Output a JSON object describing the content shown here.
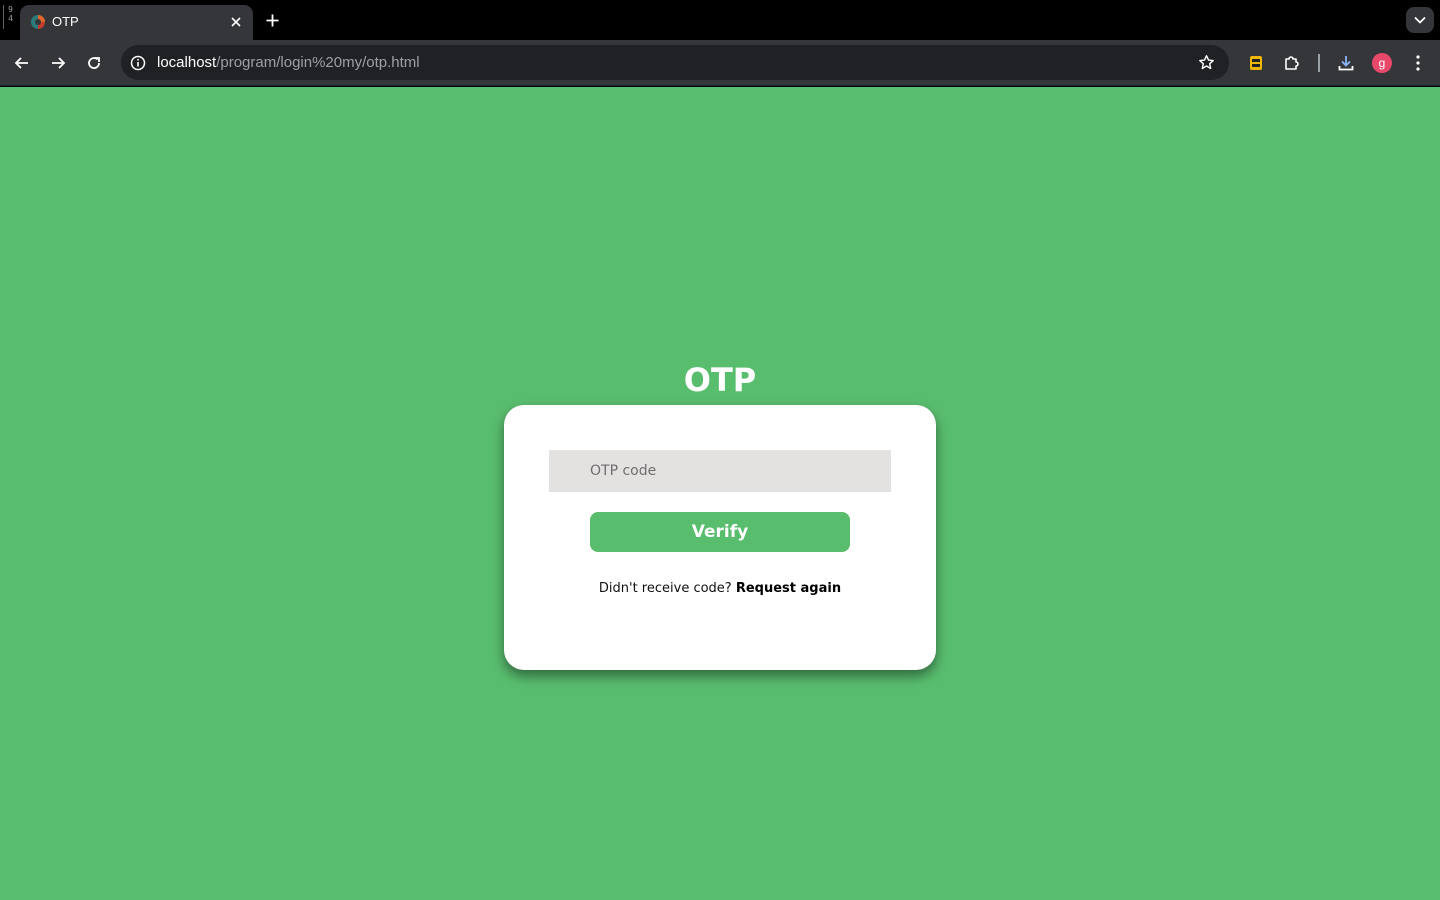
{
  "browser": {
    "os_badge": "9\n4",
    "tab": {
      "title": "OTP"
    },
    "address": {
      "host": "localhost",
      "path": "/program/login%20my/otp.html"
    },
    "profile": {
      "initial": "g",
      "color": "#e8496a"
    }
  },
  "page": {
    "background": "#59bd6e",
    "title": "OTP",
    "form": {
      "otp_placeholder": "OTP code",
      "otp_value": "",
      "verify_label": "Verify",
      "resend_prompt": "Didn't receive code?",
      "resend_link": "Request again"
    }
  }
}
